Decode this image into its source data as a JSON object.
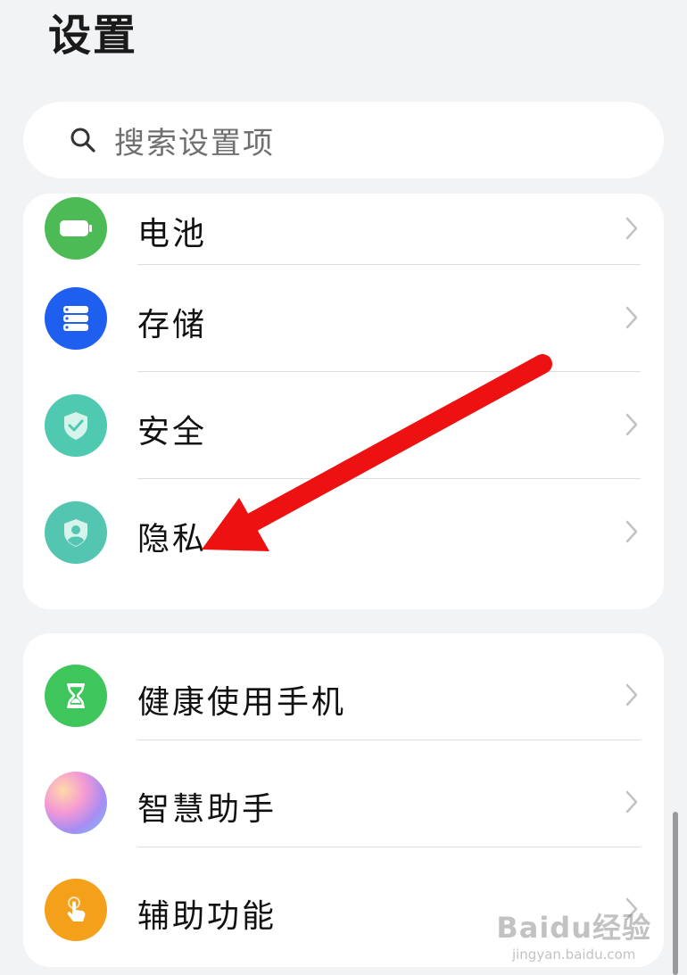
{
  "header": {
    "title": "设置"
  },
  "search": {
    "placeholder": "搜索设置项",
    "icon": "search-icon"
  },
  "groups": [
    {
      "items": [
        {
          "label": "电池",
          "icon": "battery-icon",
          "color": "#4cbb56"
        },
        {
          "label": "存储",
          "icon": "storage-icon",
          "color": "#1e5ff0"
        },
        {
          "label": "安全",
          "icon": "shield-check-icon",
          "color": "#4fc9b0"
        },
        {
          "label": "隐私",
          "icon": "privacy-shield-icon",
          "color": "#53c5b0"
        }
      ]
    },
    {
      "items": [
        {
          "label": "健康使用手机",
          "icon": "hourglass-icon",
          "color": "#3ec55b"
        },
        {
          "label": "智慧助手",
          "icon": "assistant-orb-icon",
          "color": "#d98ad8"
        },
        {
          "label": "辅助功能",
          "icon": "hand-pointer-icon",
          "color": "#f5a01b"
        }
      ]
    }
  ],
  "annotation": {
    "arrow_color": "#ee1111",
    "points_to": "隐私"
  },
  "watermark": {
    "logo": "Baidu经验",
    "url": "jingyan.baidu.com"
  }
}
